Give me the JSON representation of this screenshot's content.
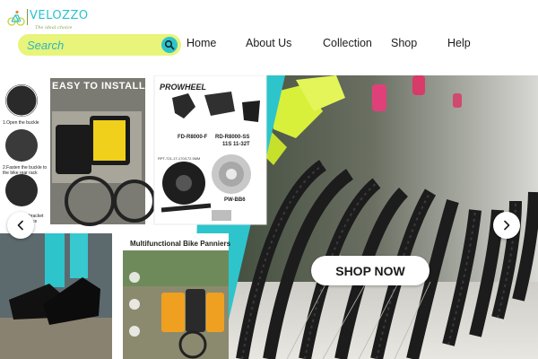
{
  "brand": {
    "name": "VELOZZO",
    "tagline": "The ideal choice",
    "logo_icon": "bicycle-icon"
  },
  "search": {
    "placeholder": "Search",
    "icon": "search-icon"
  },
  "nav": {
    "items": [
      {
        "label": "Home"
      },
      {
        "label": "About Us"
      },
      {
        "label": "Collection"
      },
      {
        "label": "Shop"
      },
      {
        "label": "Help"
      }
    ]
  },
  "hero": {
    "cta_label": "SHOP NOW",
    "prev_icon": "chevron-left-icon",
    "next_icon": "chevron-right-icon",
    "collage": {
      "install_title": "EASY TO INSTALL",
      "step_1": "1.Open the buckle",
      "step_2": "2.Fasten the buckle to the bike rear rack",
      "step_3": "bracket",
      "step_3b": "ce",
      "groupset_brand": "PROWHEEL",
      "part_1": "FD-R8000-F",
      "part_2": "RD-R8000-SS",
      "part_2_sub": "11S 11-32T",
      "part_3": "RPT-721-1T-170/172.5MM",
      "part_4": "PW-BB6",
      "panniers_title": "Multifunctional Bike Panniers"
    }
  },
  "colors": {
    "accent_teal": "#2ec4cc",
    "accent_yellow": "#e8f47a",
    "text_dark": "#1c1c1c"
  }
}
